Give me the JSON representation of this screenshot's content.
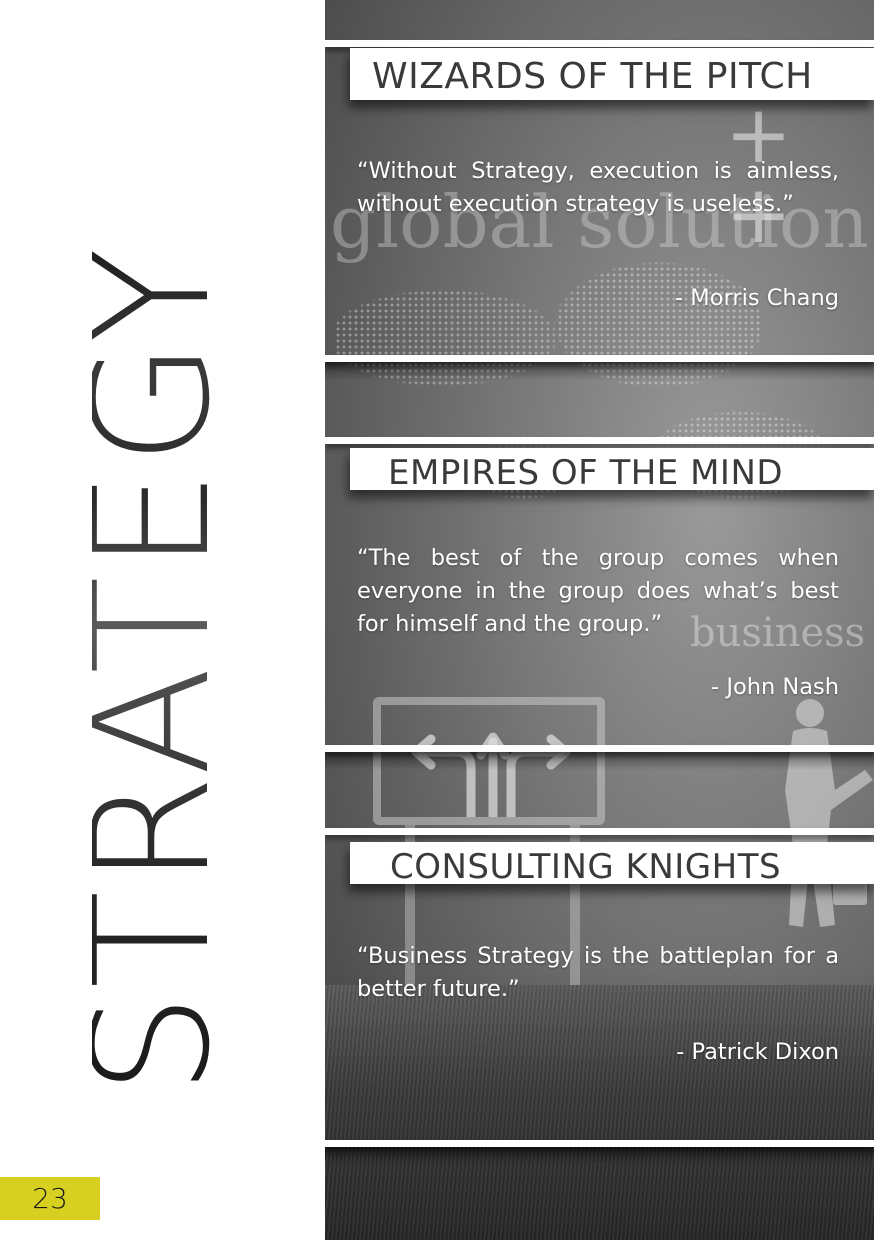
{
  "page": {
    "title": "STRATEGY",
    "number": "23",
    "accent_color": "#d7d020"
  },
  "background_text": {
    "global": "global solution",
    "business": "business p"
  },
  "sections": [
    {
      "heading": "WIZARDS OF THE PITCH",
      "quote": "“Without Strategy, execution is aimless, without execution strategy is useless.”",
      "author": "- Morris Chang"
    },
    {
      "heading": "EMPIRES OF THE MIND",
      "quote": "“The best of the group comes when everyone in the group does what’s best for himself and the group.”",
      "author": "- John Nash"
    },
    {
      "heading": "CONSULTING KNIGHTS",
      "quote": "“Business Strategy is the battleplan for a better future.”",
      "author": "- Patrick Dixon"
    }
  ],
  "icons": {
    "road_sign": "direction-arrows-sign-icon",
    "person": "person-silhouette-icon"
  }
}
